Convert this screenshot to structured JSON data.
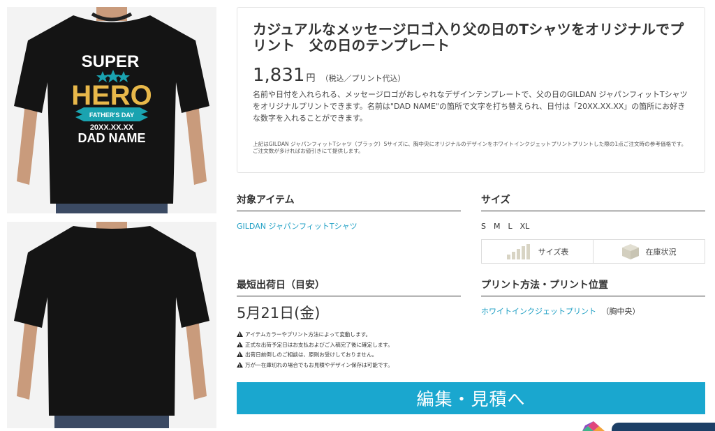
{
  "product": {
    "title": "カジュアルなメッセージロゴ入り父の日のTシャツをオリジナルでプリント　父の日のテンプレート",
    "price": "1,831",
    "price_unit": "円",
    "price_note": "（税込／プリント代込）",
    "description": "名前や日付を入れられる、メッセージロゴがおしゃれなデザインテンプレートで、父の日のGILDAN ジャパンフィットTシャツをオリジナルプリントできます。名前は\"DAD NAME\"の箇所で文字を打ち替えられ、日付は「20XX.XX.XX」の箇所にお好きな数字を入れることができます。",
    "fine_print": "上記はGILDAN ジャパンフィットTシャツ（ブラック）Sサイズに、胸中央にオリジナルのデザインをホワイトインクジェットプリントプリントした際の1点ご注文時の参考価格です。ご注文数が多ければお値引きにて提供します。"
  },
  "design": {
    "line1": "SUPER",
    "line2": "HERO",
    "ribbon": "FATHER'S DAY",
    "date": "20XX.XX.XX",
    "name": "DAD NAME"
  },
  "item": {
    "heading": "対象アイテム",
    "link": "GILDAN ジャパンフィットTシャツ"
  },
  "size": {
    "heading": "サイズ",
    "options": "S　M　L　XL",
    "chart_button": "サイズ表",
    "stock_button": "在庫状況"
  },
  "shipping": {
    "heading": "最短出荷日（目安）",
    "date": "5月21日(金)",
    "notes": [
      "アイテムカラーやプリント方法によって変動します。",
      "正式な出荷予定日はお支払およびご入稿完了後に確定します。",
      "出荷日前倒しのご相談は、原則お受けしておりません。",
      "万が一在庫切れの場合でもお見積やデザイン保存は可能です。"
    ]
  },
  "print": {
    "heading": "プリント方法・プリント位置",
    "method_link": "ホワイトインクジェットプリント",
    "position": "（胸中央）"
  },
  "cta": {
    "label": "編集・見積へ"
  },
  "colors": {
    "accent": "#1aa7cf",
    "link": "#1e9fc4",
    "hero_gold": "#e8b84a",
    "ribbon_teal": "#1aa3b0"
  }
}
